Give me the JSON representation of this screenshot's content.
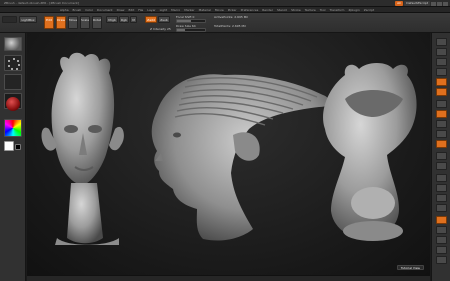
{
  "window": {
    "title": "ZBrush - default-zbrush.ZPR - [ZBrush Document]",
    "right_buttons": [
      "AC",
      "DefaultZScript"
    ]
  },
  "menubar": {
    "items": [
      "Alpha",
      "Brush",
      "Color",
      "Document",
      "Draw",
      "Edit",
      "File",
      "Layer",
      "Light",
      "Macro",
      "Marker",
      "Material",
      "Movie",
      "Picker",
      "Preferences",
      "Render",
      "Stencil",
      "Stroke",
      "Texture",
      "Tool",
      "Transform",
      "Zplugin",
      "Zscript"
    ]
  },
  "toolbar": {
    "lightbox_label": "LightBox",
    "edit_label": "Edit",
    "draw_label": "Draw",
    "move_label": "Move",
    "scale_label": "Scale",
    "rotate_label": "Rotate",
    "mrgb_label": "Mrgb",
    "rgb_label": "Rgb",
    "m_label": "M",
    "zadd_label": "Zadd",
    "zsub_label": "Zsub",
    "focal_shift_label": "Focal Shift 0",
    "draw_size_label": "Draw Size 64",
    "z_intensity_label": "Z Intensity 25",
    "active_points_label": "ActivePoints: 2.695 Mil",
    "total_points_label": "TotalPoints: 2.695 Mil",
    "focal_shift_value": 0.5,
    "draw_size_value": 0.3,
    "z_intensity_value": 0.25
  },
  "viewport": {
    "tutorial_label": "Tutorial View"
  },
  "colors": {
    "accent": "#e0701e",
    "clay": "#a8a8a8",
    "background": "#1b1b1b"
  }
}
